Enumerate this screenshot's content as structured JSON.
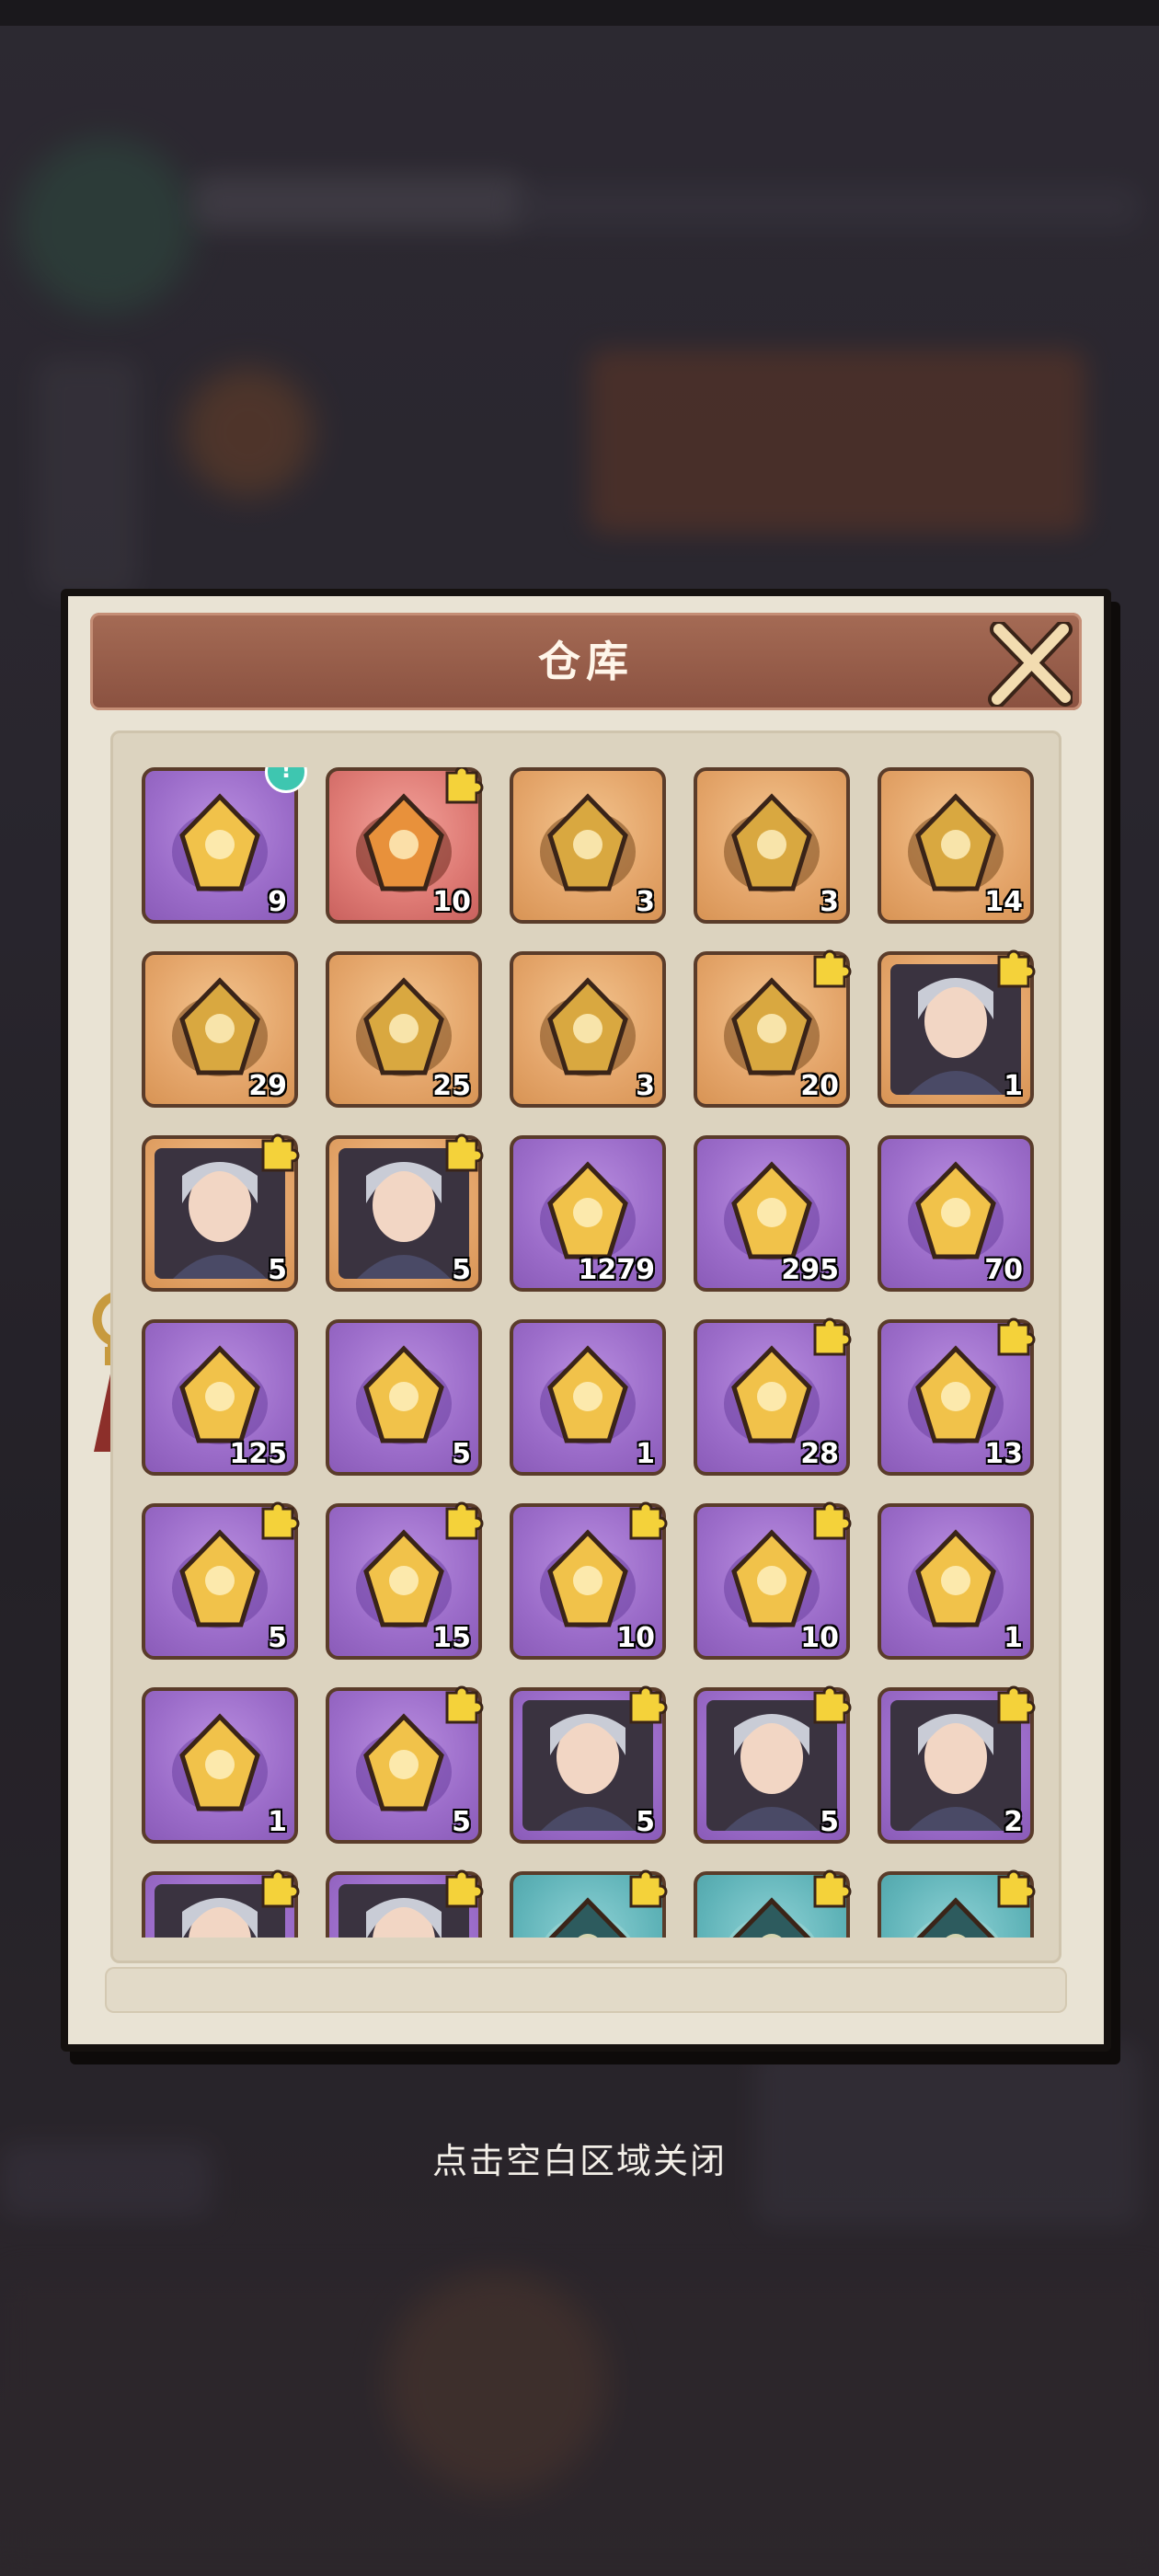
{
  "dialog": {
    "title": "仓库"
  },
  "close_hint": "点击空白区域关闭",
  "items": [
    {
      "bg": "purple",
      "icon": "golden-chest-icon",
      "count": "9",
      "fragment": false,
      "alert": true
    },
    {
      "bg": "red",
      "icon": "flaming-demon-mask-icon",
      "count": "10",
      "fragment": true
    },
    {
      "bg": "orange",
      "icon": "golden-key-icon",
      "count": "3",
      "fragment": false
    },
    {
      "bg": "orange",
      "icon": "jade-book-icon",
      "count": "3",
      "fragment": false
    },
    {
      "bg": "orange",
      "icon": "red-scroll-icon",
      "count": "14",
      "fragment": false
    },
    {
      "bg": "orange",
      "icon": "ornate-key-icon",
      "count": "29",
      "fragment": false
    },
    {
      "bg": "orange",
      "icon": "golden-scroll-icon",
      "count": "25",
      "fragment": false
    },
    {
      "bg": "orange",
      "icon": "elemental-gem-icon",
      "count": "3",
      "fragment": false
    },
    {
      "bg": "orange",
      "icon": "silver-amulet-icon",
      "count": "20",
      "fragment": true
    },
    {
      "bg": "orange",
      "icon": "white-haired-hero-portrait",
      "count": "1",
      "fragment": true
    },
    {
      "bg": "orange",
      "icon": "blue-haired-girl-portrait",
      "count": "5",
      "fragment": true
    },
    {
      "bg": "orange",
      "icon": "dark-haired-hero-portrait",
      "count": "5",
      "fragment": true
    },
    {
      "bg": "purple",
      "icon": "blue-crystal-icon",
      "count": "1279",
      "fragment": false
    },
    {
      "bg": "purple",
      "icon": "gold-coin-icon",
      "count": "295",
      "fragment": false
    },
    {
      "bg": "purple",
      "icon": "sword-badge-icon",
      "count": "70",
      "fragment": false
    },
    {
      "bg": "purple",
      "icon": "red-token-icon",
      "count": "125",
      "fragment": false
    },
    {
      "bg": "purple",
      "icon": "star-coin-icon",
      "count": "5",
      "fragment": false
    },
    {
      "bg": "purple",
      "icon": "crystal-orb-icon",
      "count": "1",
      "fragment": false
    },
    {
      "bg": "purple",
      "icon": "dragon-ring-icon",
      "count": "28",
      "fragment": true
    },
    {
      "bg": "purple",
      "icon": "fire-bird-icon",
      "count": "13",
      "fragment": true
    },
    {
      "bg": "purple",
      "icon": "green-spear-icon",
      "count": "5",
      "fragment": true
    },
    {
      "bg": "purple",
      "icon": "stone-pillar-icon",
      "count": "15",
      "fragment": true
    },
    {
      "bg": "purple",
      "icon": "dark-helmet-icon",
      "count": "10",
      "fragment": true
    },
    {
      "bg": "purple",
      "icon": "black-gold-cannon-icon",
      "count": "10",
      "fragment": true
    },
    {
      "bg": "purple",
      "icon": "bronze-medal-icon",
      "count": "1",
      "fragment": false
    },
    {
      "bg": "purple",
      "icon": "silver-medal-icon",
      "count": "1",
      "fragment": false
    },
    {
      "bg": "purple",
      "icon": "green-spirit-icon",
      "count": "5",
      "fragment": true
    },
    {
      "bg": "purple",
      "icon": "gray-haired-hero-portrait",
      "count": "5",
      "fragment": true
    },
    {
      "bg": "purple",
      "icon": "green-beast-portrait",
      "count": "5",
      "fragment": true
    },
    {
      "bg": "purple",
      "icon": "silver-haired-girl-portrait",
      "count": "2",
      "fragment": true
    },
    {
      "bg": "purple",
      "icon": "hero-portrait",
      "count": "",
      "fragment": true
    },
    {
      "bg": "purple",
      "icon": "hero-portrait",
      "count": "",
      "fragment": true
    },
    {
      "bg": "teal",
      "icon": "dark-helmet-icon",
      "count": "",
      "fragment": true
    },
    {
      "bg": "teal",
      "icon": "stone-pillar-icon",
      "count": "",
      "fragment": true
    },
    {
      "bg": "teal",
      "icon": "green-spear-icon",
      "count": "",
      "fragment": true
    }
  ]
}
